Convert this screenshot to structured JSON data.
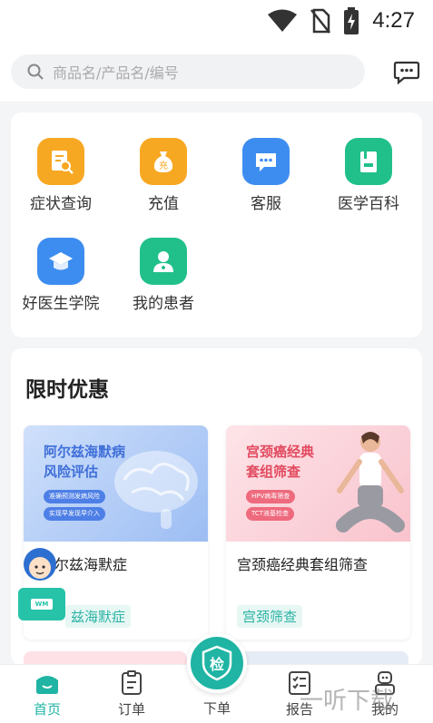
{
  "status_bar": {
    "time": "4:27"
  },
  "search": {
    "placeholder": "商品名/产品名/编号"
  },
  "grid": [
    {
      "label": "症状查询",
      "icon": "symptom-search-icon",
      "color": "#f7a823"
    },
    {
      "label": "充值",
      "icon": "money-bag-icon",
      "color": "#f7a823"
    },
    {
      "label": "客服",
      "icon": "chat-icon",
      "color": "#3d8df0"
    },
    {
      "label": "医学百科",
      "icon": "encyclopedia-icon",
      "color": "#21c08b"
    },
    {
      "label": "好医生学院",
      "icon": "graduation-cap-icon",
      "color": "#3d8df0"
    },
    {
      "label": "我的患者",
      "icon": "patient-icon",
      "color": "#21c08b"
    }
  ],
  "promo": {
    "title": "限时优惠",
    "products": [
      {
        "banner_title_1": "阿尔兹海默病",
        "banner_title_2": "风险评估",
        "pill_1": "准确预测发病风险",
        "pill_2": "实现早发现早介入",
        "name": "尔兹海默症",
        "tag": "兹海默症"
      },
      {
        "banner_title_1": "宫颈癌经典",
        "banner_title_2": "套组筛查",
        "pill_1": "HPV病毒筛查",
        "pill_2": "TCT液基检查",
        "name": "宫颈癌经典套组筛查",
        "tag": "宫颈筛查"
      }
    ]
  },
  "tabbar": {
    "home": "首页",
    "orders": "订单",
    "place_order": "下单",
    "center_icon_text": "检",
    "reports": "报告",
    "mine": "我的"
  },
  "mascot_badge": "WM",
  "watermark": "一听下载",
  "colors": {
    "accent": "#1fb4a3",
    "tag_bg": "#e7f7f4"
  }
}
